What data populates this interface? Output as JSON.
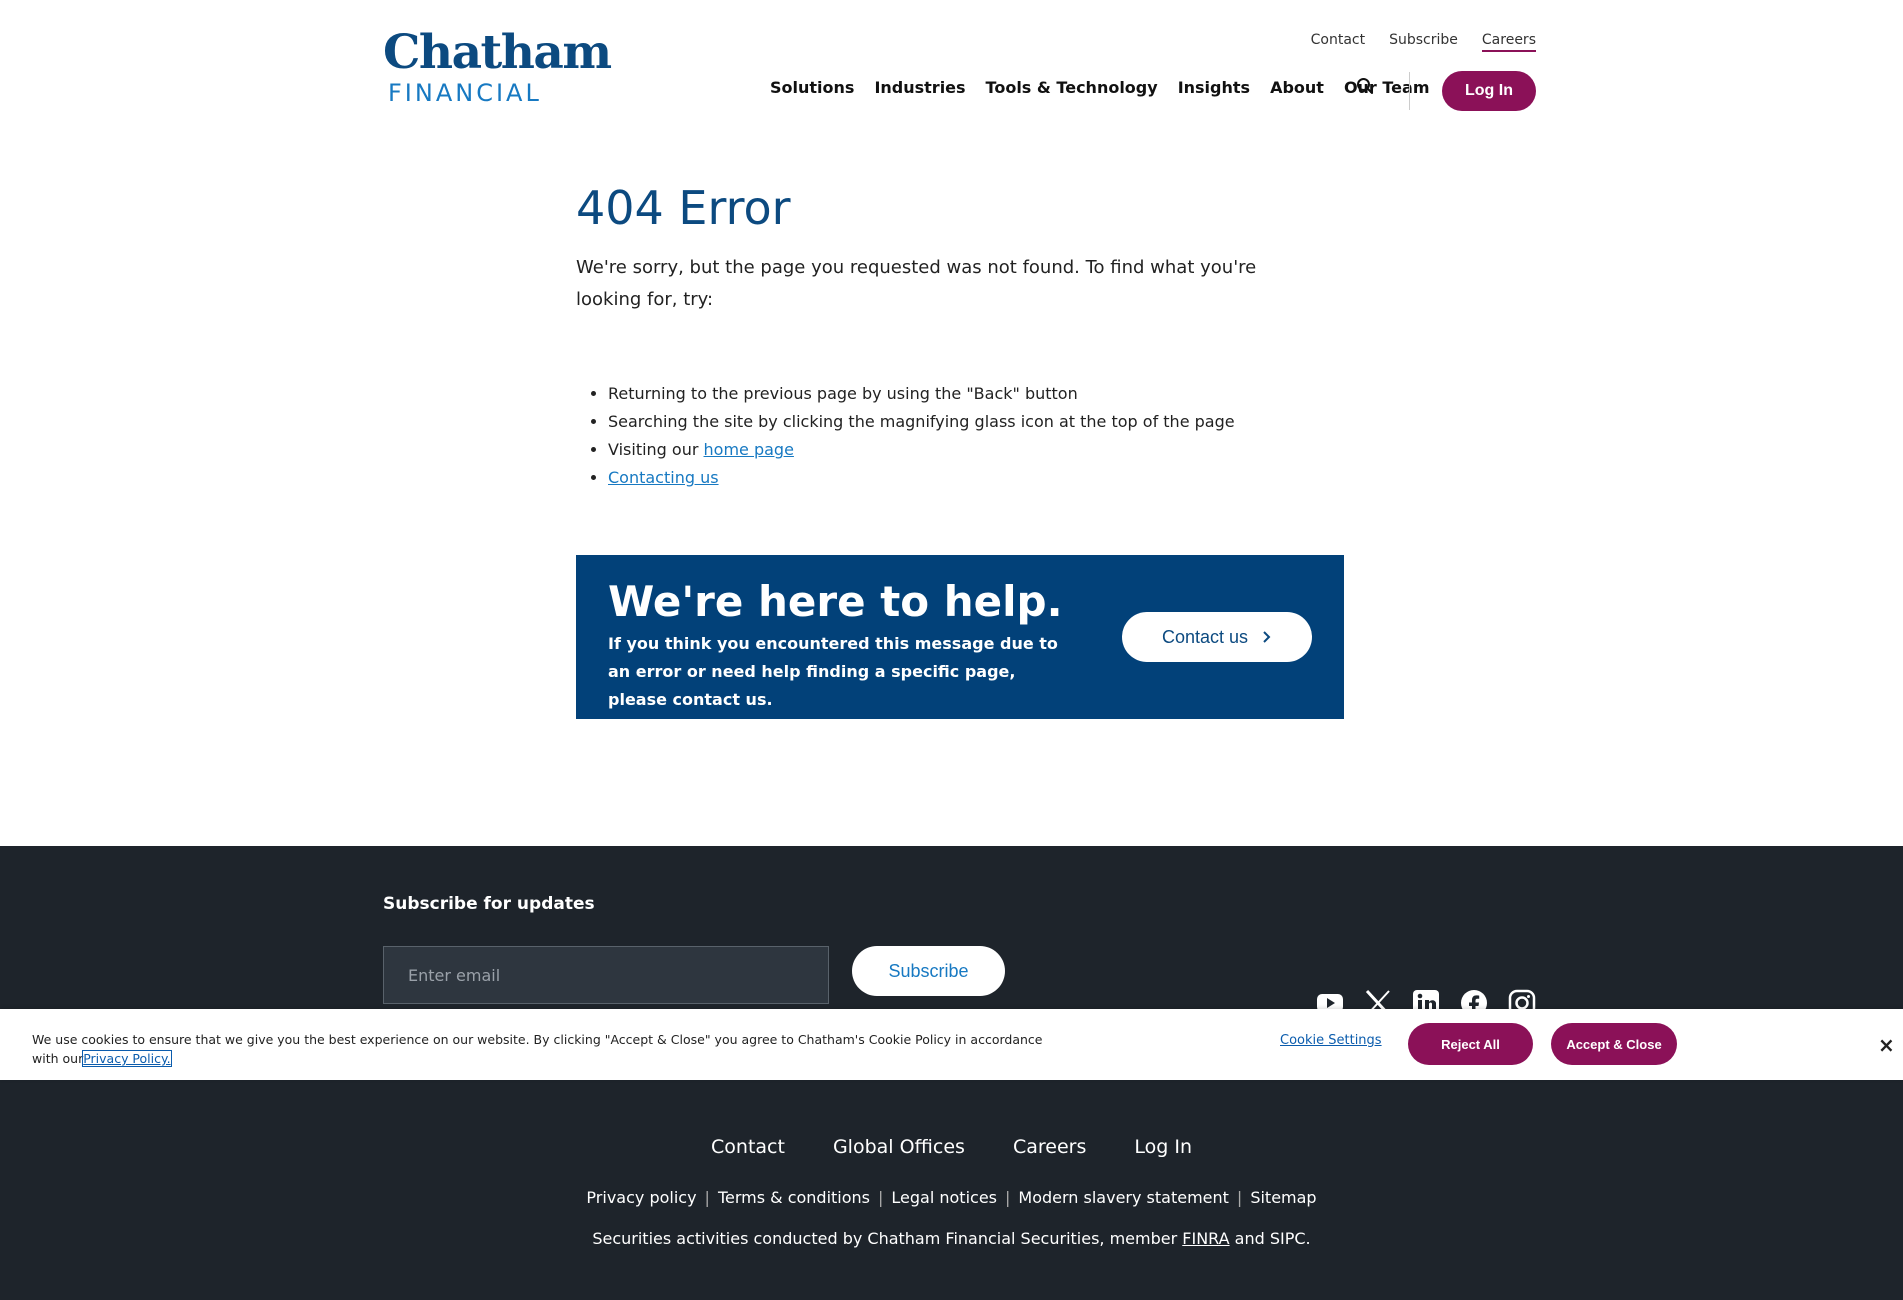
{
  "header": {
    "logo_top": "Chatham",
    "logo_bottom": "FINANCIAL",
    "util_nav": [
      "Contact",
      "Subscribe",
      "Careers"
    ],
    "main_nav": [
      "Solutions",
      "Industries",
      "Tools & Technology",
      "Insights",
      "About",
      "Our Team"
    ],
    "login_label": "Log In"
  },
  "main": {
    "title": "404 Error",
    "lead": "We're sorry, but the page you requested was not found. To find what you're looking for, try:",
    "list": {
      "item1": "Returning to the previous page by using the \"Back\" button",
      "item2": "Searching the site by clicking the magnifying glass icon at the top of the page",
      "item3_prefix": "Visiting our ",
      "item3_link": "home page",
      "item4_link": "Contacting us"
    }
  },
  "help": {
    "title": "We're here to help.",
    "text": "If you think you encountered this message due to an error or need help finding a specific page, please contact us.",
    "button": "Contact us"
  },
  "footer": {
    "subscribe_title": "Subscribe for updates",
    "email_placeholder": "Enter email",
    "subscribe_button": "Subscribe",
    "links_primary": [
      "Contact",
      "Global Offices",
      "Careers",
      "Log In"
    ],
    "links_secondary": [
      "Privacy policy",
      "Terms & conditions",
      "Legal notices",
      "Modern slavery statement",
      "Sitemap"
    ],
    "disclosure_prefix": "Securities activities conducted by Chatham Financial Securities, member ",
    "disclosure_link": "FINRA",
    "disclosure_suffix": " and SIPC.",
    "social_icons": [
      "youtube-icon",
      "x-icon",
      "linkedin-icon",
      "facebook-icon",
      "instagram-icon"
    ]
  },
  "cookie": {
    "text": "We use cookies to ensure that we give you the best experience on our website. By clicking \"Accept & Close\" you agree to Chatham's Cookie Policy in accordance with our",
    "privacy_link": "Privacy Policy.",
    "settings": "Cookie Settings",
    "reject": "Reject All",
    "accept": "Accept & Close",
    "close": "×"
  },
  "colors": {
    "brand_navy": "#0c4a80",
    "brand_blue": "#1779c2",
    "accent_magenta": "#8b1158",
    "help_box": "#024179",
    "footer_bg": "#1e242b"
  }
}
